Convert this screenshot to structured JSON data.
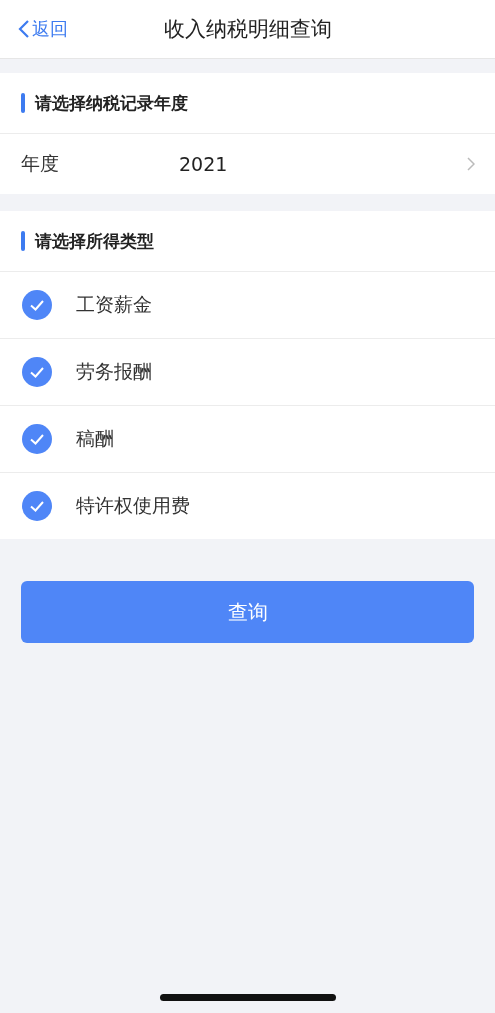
{
  "nav": {
    "back": "返回",
    "title": "收入纳税明细查询"
  },
  "year_section": {
    "heading": "请选择纳税记录年度",
    "label": "年度",
    "value": "2021"
  },
  "type_section": {
    "heading": "请选择所得类型",
    "options": [
      {
        "label": "工资薪金",
        "checked": true
      },
      {
        "label": "劳务报酬",
        "checked": true
      },
      {
        "label": "稿酬",
        "checked": true
      },
      {
        "label": "特许权使用费",
        "checked": true
      }
    ]
  },
  "query_button": "查询"
}
